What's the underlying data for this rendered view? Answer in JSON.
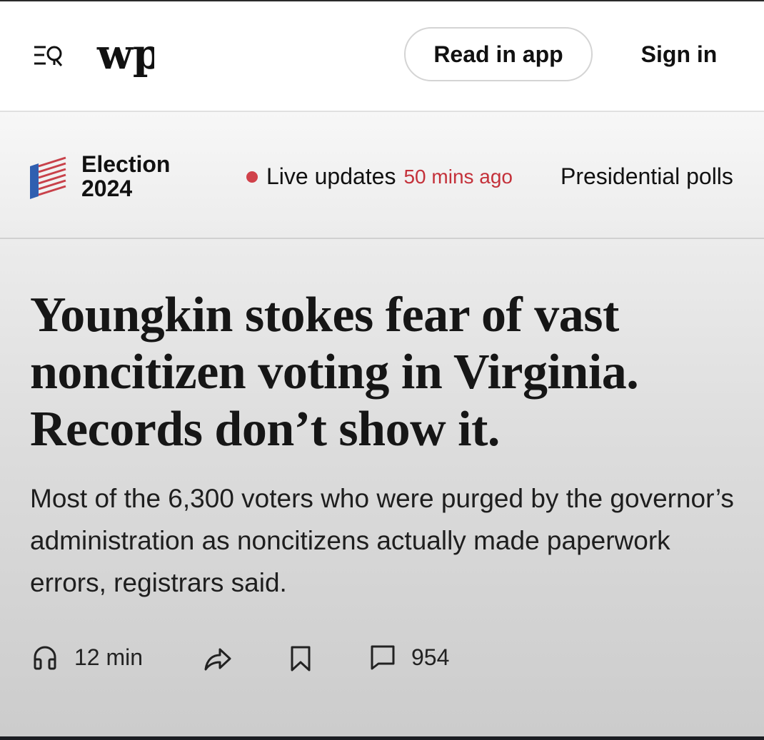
{
  "header": {
    "menu_icon": "menu-search-icon",
    "logo_text": "wp",
    "read_in_app_label": "Read in app",
    "sign_in_label": "Sign in"
  },
  "election_bar": {
    "title_line1": "Election",
    "title_line2": "2024",
    "live_label": "Live updates",
    "live_time": "50 mins ago",
    "polls_label": "Presidential polls",
    "live_dot_color": "#d0414a"
  },
  "article": {
    "headline": "Youngkin stokes fear of vast noncitizen voting in Virginia. Records don’t show it.",
    "dek": "Most of the 6,300 voters who were purged by the governor’s administration as noncitizens actually made paperwork errors, registrars said."
  },
  "actions": {
    "listen_icon": "headphones-icon",
    "listen_label": "12 min",
    "share_icon": "share-icon",
    "save_icon": "bookmark-icon",
    "comments_icon": "comment-icon",
    "comments_count": "954"
  }
}
